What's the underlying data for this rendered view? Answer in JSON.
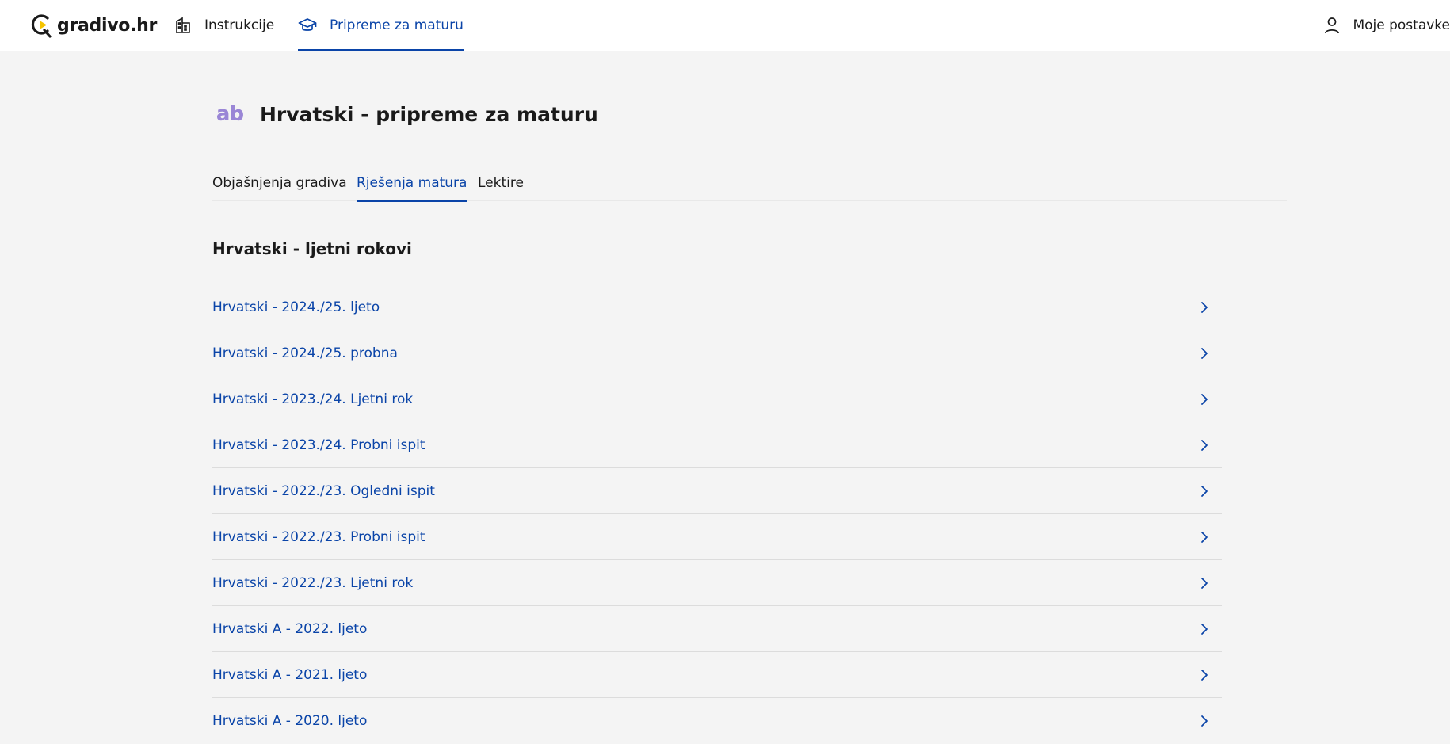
{
  "header": {
    "logo_text": "gradivo.hr",
    "nav": [
      {
        "label": "Instrukcije",
        "icon": "building-icon"
      },
      {
        "label": "Pripreme za maturu",
        "icon": "graduation-cap-icon",
        "active": true
      }
    ],
    "settings_label": "Moje postavke",
    "settings_icon": "user-icon"
  },
  "page": {
    "icon_text": "ab",
    "title": "Hrvatski - pripreme za maturu"
  },
  "tabs": [
    {
      "label": "Objašnjenja gradiva"
    },
    {
      "label": "Rješenja matura",
      "active": true
    },
    {
      "label": "Lektire"
    }
  ],
  "section": {
    "title": "Hrvatski - ljetni rokovi",
    "items": [
      {
        "label": "Hrvatski - 2024./25. ljeto"
      },
      {
        "label": "Hrvatski - 2024./25. probna"
      },
      {
        "label": "Hrvatski - 2023./24. Ljetni rok"
      },
      {
        "label": "Hrvatski - 2023./24. Probni ispit"
      },
      {
        "label": "Hrvatski - 2022./23. Ogledni ispit"
      },
      {
        "label": "Hrvatski - 2022./23. Probni ispit"
      },
      {
        "label": "Hrvatski - 2022./23. Ljetni rok"
      },
      {
        "label": "Hrvatski A - 2022. ljeto"
      },
      {
        "label": "Hrvatski A - 2021. ljeto"
      },
      {
        "label": "Hrvatski A - 2020. ljeto"
      }
    ]
  },
  "colors": {
    "accent": "#0a44a8",
    "background": "#f4f4f4",
    "subject_icon": "#9a86d6",
    "logo_yellow": "#f5c400"
  }
}
